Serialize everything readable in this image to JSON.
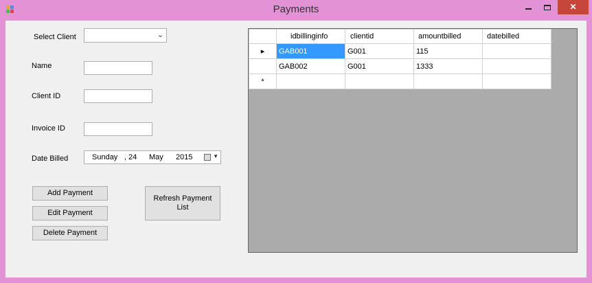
{
  "window": {
    "title": "Payments",
    "controls": {
      "minimize": "–",
      "maximize": "□",
      "close": "✕"
    }
  },
  "form": {
    "select_client_label": "Select Client",
    "select_client_value": "",
    "name_label": "Name",
    "name_value": "",
    "client_id_label": "Client ID",
    "client_id_value": "",
    "invoice_id_label": "Invoice ID",
    "invoice_id_value": "",
    "date_billed_label": "Date Billed",
    "date": {
      "weekday": "Sunday",
      "sep": ",",
      "day": "24",
      "month": "May",
      "year": "2015"
    }
  },
  "buttons": {
    "add": "Add Payment",
    "edit": "Edit Payment",
    "delete": "Delete Payment",
    "refresh": "Refresh Payment List"
  },
  "grid": {
    "columns": [
      "idbillinginfo",
      "clientid",
      "amountbilled",
      "datebilled"
    ],
    "rows": [
      {
        "marker": "▸",
        "cells": [
          "GAB001",
          "G001",
          "115",
          ""
        ]
      },
      {
        "marker": "",
        "cells": [
          "GAB002",
          "G001",
          "1333",
          ""
        ]
      },
      {
        "marker": "*",
        "cells": [
          "",
          "",
          "",
          ""
        ]
      }
    ]
  },
  "colors": {
    "titlebar": "#e292d5",
    "close_button": "#c7463c",
    "selected_cell": "#3399ff",
    "grid_background": "#ababab"
  }
}
